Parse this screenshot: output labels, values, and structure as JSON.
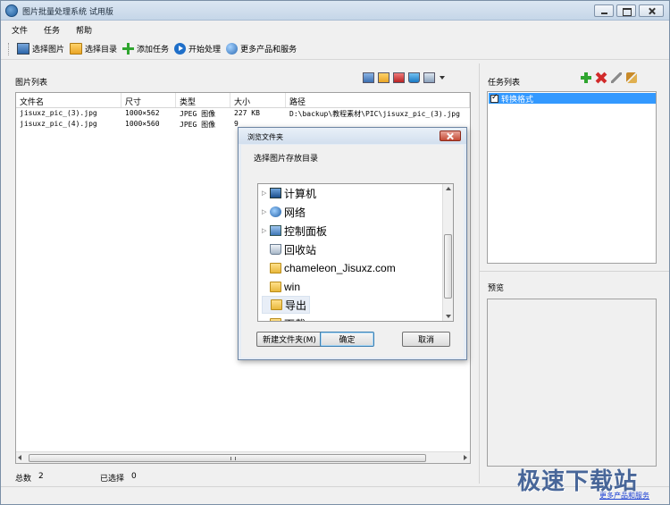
{
  "window": {
    "title": "图片批量处理系统 试用版"
  },
  "menu": [
    "文件",
    "任务",
    "帮助"
  ],
  "toolbar": {
    "select_image": "选择图片",
    "select_dir": "选择目录",
    "add_task": "添加任务",
    "start": "开始处理",
    "more": "更多产品和服务"
  },
  "image_list": {
    "label": "图片列表",
    "columns": [
      "文件名",
      "尺寸",
      "类型",
      "大小",
      "路径"
    ],
    "rows": [
      [
        "jisuxz_pic_(3).jpg",
        "1000×562",
        "JPEG 图像",
        "227 KB",
        "D:\\backup\\教程素材\\PIC\\jisuxz_pic_(3).jpg"
      ],
      [
        "jisuxz_pic_(4).jpg",
        "1000×560",
        "JPEG 图像",
        "9",
        ""
      ]
    ]
  },
  "footer": {
    "total_label": "总数",
    "total_value": "2",
    "selected_label": "已选择",
    "selected_value": "0"
  },
  "task_list": {
    "label": "任务列表",
    "items": [
      {
        "label": "转换格式",
        "checked": true
      }
    ]
  },
  "preview": {
    "label": "预览"
  },
  "statusbar": {
    "link": "更多产品和服务",
    "watermark": "极速下载站"
  },
  "dialog": {
    "title": "浏览文件夹",
    "prompt": "选择图片存放目录",
    "tree": [
      {
        "label": "计算机",
        "icon": "computer-icon",
        "expandable": true
      },
      {
        "label": "网络",
        "icon": "network-icon",
        "expandable": true
      },
      {
        "label": "控制面板",
        "icon": "control-panel-icon",
        "expandable": true
      },
      {
        "label": "回收站",
        "icon": "recycle-bin-icon",
        "expandable": false
      },
      {
        "label": "chameleon_Jisuxz.com",
        "icon": "folder-icon",
        "expandable": false
      },
      {
        "label": "win",
        "icon": "folder-icon",
        "expandable": false
      },
      {
        "label": "导出",
        "icon": "folder-icon",
        "expandable": false,
        "selected": true
      },
      {
        "label": "下载",
        "icon": "folder-icon",
        "expandable": false
      }
    ],
    "new_folder": "新建文件夹(M)",
    "ok": "确定",
    "cancel": "取消"
  }
}
